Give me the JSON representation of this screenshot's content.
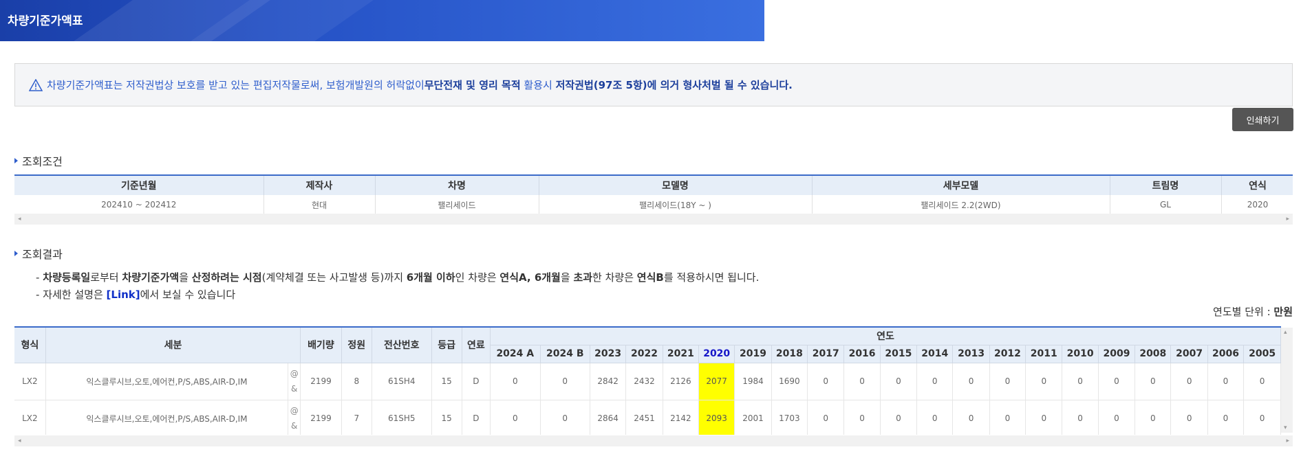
{
  "header": {
    "title": "차량기준가액표"
  },
  "notice": {
    "text_normal": "차량기준가액표는 저작권법상 보호를 받고 있는 편집저작물로써, 보험개발원의 허락없이 ",
    "text_bold": "무단전재 및 영리 목적",
    "text_normal2": " 활용시 ",
    "text_bold2": "저작권법(97조 5항)에 의거 형사처벌 될 수 있습니다."
  },
  "print_label": "인쇄하기",
  "conditions": {
    "title": "조회조건",
    "headers": [
      "기준년월",
      "제작사",
      "차명",
      "모델명",
      "세부모델",
      "트림명",
      "연식"
    ],
    "values": [
      "202410 ~ 202412",
      "현대",
      "팰리세이드",
      "팰리세이드(18Y ~ )",
      "팰리세이드 2.2(2WD)",
      "GL",
      "2020"
    ]
  },
  "results": {
    "title": "조회결과",
    "desc1": {
      "prefix": "- ",
      "b1": "차량등록일",
      "t1": "로부터 ",
      "b2": "차량기준가액",
      "t2": "을 ",
      "b3": "산정하려는 시점",
      "t3": "(계약체결 또는 사고발생 등)까지 ",
      "b4": "6개월 이하",
      "t4": "인 차량은 ",
      "b5": "연식A, 6개월",
      "t5": "을 ",
      "b6": "초과",
      "t6": "한 차량은 ",
      "b7": "연식B",
      "t7": "를 적용하시면 됩니다."
    },
    "desc2": {
      "prefix": "- 자세한 설명은 ",
      "link": "[Link]",
      "suffix": "에서 보실 수 있습니다"
    },
    "unit_label": "연도별 단위 : ",
    "unit_value": "만원",
    "headers": {
      "type": "형식",
      "detail": "세분",
      "cc": "배기량",
      "seats": "정원",
      "code": "전산번호",
      "grade": "등급",
      "fuel": "연료",
      "years_group": "연도"
    },
    "years": [
      "2024 A",
      "2024 B",
      "2023",
      "2022",
      "2021",
      "2020",
      "2019",
      "2018",
      "2017",
      "2016",
      "2015",
      "2014",
      "2013",
      "2012",
      "2011",
      "2010",
      "2009",
      "2008",
      "2007",
      "2006",
      "2005"
    ],
    "highlight_year": "2020",
    "rows": [
      {
        "type": "LX2",
        "detail": "익스클루시브,오토,에어컨,P/S,ABS,AIR-D,IM",
        "sym1": "@",
        "sym2": "&",
        "cc": "2199",
        "seats": "8",
        "code": "61SH4",
        "grade": "15",
        "fuel": "D",
        "values": [
          "0",
          "0",
          "2842",
          "2432",
          "2126",
          "2077",
          "1984",
          "1690",
          "0",
          "0",
          "0",
          "0",
          "0",
          "0",
          "0",
          "0",
          "0",
          "0",
          "0",
          "0",
          "0"
        ]
      },
      {
        "type": "LX2",
        "detail": "익스클루시브,오토,에어컨,P/S,ABS,AIR-D,IM",
        "sym1": "@",
        "sym2": "&",
        "cc": "2199",
        "seats": "7",
        "code": "61SH5",
        "grade": "15",
        "fuel": "D",
        "values": [
          "0",
          "0",
          "2864",
          "2451",
          "2142",
          "2093",
          "2001",
          "1703",
          "0",
          "0",
          "0",
          "0",
          "0",
          "0",
          "0",
          "0",
          "0",
          "0",
          "0",
          "0",
          "0"
        ]
      }
    ]
  },
  "colors": {
    "accent": "#3a6ac9",
    "highlight": "#ffff00",
    "header_bg": "#e6eef8"
  }
}
